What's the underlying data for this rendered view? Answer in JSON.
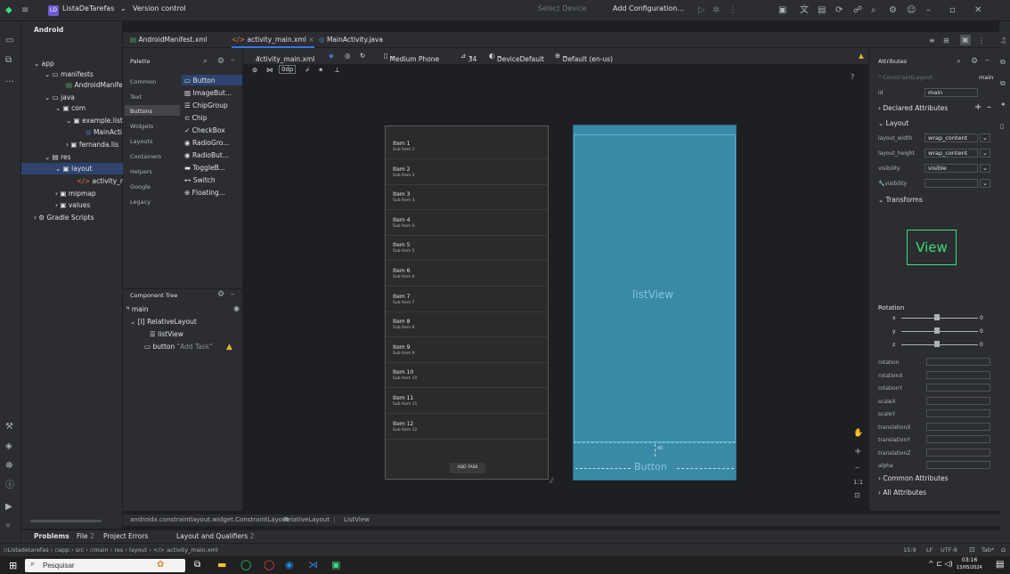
{
  "titlebar": {
    "project_badge": "LD",
    "project_name": "ListaDeTarefas",
    "vcs": "Version control",
    "select_device": "Select Device",
    "run_config": "Add Configuration..."
  },
  "project_panel": {
    "view_mode": "Android",
    "tree": [
      {
        "label": "app"
      },
      {
        "label": "manifests"
      },
      {
        "label": "AndroidManife"
      },
      {
        "label": "java"
      },
      {
        "label": "com"
      },
      {
        "label": "example.list"
      },
      {
        "label": "MainActi"
      },
      {
        "label": "fernanda.lis"
      },
      {
        "label": "res"
      },
      {
        "label": "layout"
      },
      {
        "label": "activity_mai"
      },
      {
        "label": "mipmap"
      },
      {
        "label": "values"
      },
      {
        "label": "Gradle Scripts"
      }
    ]
  },
  "editor_tabs": [
    "AndroidManifest.xml",
    "activity_main.xml",
    "MainActivity.java"
  ],
  "palette": {
    "title": "Palette",
    "categories": [
      "Common",
      "Text",
      "Buttons",
      "Widgets",
      "Layouts",
      "Containers",
      "Helpers",
      "Google",
      "Legacy"
    ],
    "items": [
      "Button",
      "ImageBut...",
      "ChipGroup",
      "Chip",
      "CheckBox",
      "RadioGro...",
      "RadioBut...",
      "ToggleB...",
      "Switch",
      "Floating..."
    ]
  },
  "design_toolbar": {
    "file": "activity_main.xml",
    "dp": "0dp",
    "device": "Medium Phone",
    "api": "34",
    "theme": "DeviceDefault",
    "locale": "Default (en-us)"
  },
  "component_tree": {
    "title": "Component Tree",
    "root": "main",
    "relative": "RelativeLayout",
    "list": "listView",
    "button": "button",
    "button_hint": "\"Add Task\""
  },
  "preview": {
    "items": [
      {
        "title": "Item 1",
        "sub": "Sub Item 1"
      },
      {
        "title": "Item 2",
        "sub": "Sub Item 2"
      },
      {
        "title": "Item 3",
        "sub": "Sub Item 3"
      },
      {
        "title": "Item 4",
        "sub": "Sub Item 4"
      },
      {
        "title": "Item 5",
        "sub": "Sub Item 5"
      },
      {
        "title": "Item 6",
        "sub": "Sub Item 6"
      },
      {
        "title": "Item 7",
        "sub": "Sub Item 7"
      },
      {
        "title": "Item 8",
        "sub": "Sub Item 8"
      },
      {
        "title": "Item 9",
        "sub": "Sub Item 9"
      },
      {
        "title": "Item 10",
        "sub": "Sub Item 10"
      },
      {
        "title": "Item 11",
        "sub": "Sub Item 11"
      },
      {
        "title": "Item 12",
        "sub": "Sub Item 12"
      }
    ],
    "add_task": "ADD TASK",
    "blueprint_list": "listView",
    "blueprint_button": "Button",
    "blueprint_margin": "40"
  },
  "attributes": {
    "title": "Attributes",
    "class": "ConstraintLayout",
    "class_id": "main",
    "id_label": "id",
    "id_value": "main",
    "declared": "Declared Attributes",
    "layout": "Layout",
    "layout_width_label": "layout_width",
    "layout_width": "wrap_content",
    "layout_height_label": "layout_height",
    "layout_height": "wrap_content",
    "visibility_label": "visibility",
    "visibility": "visible",
    "tools_visibility_label": "visibility",
    "transforms": "Transforms",
    "view_box": "View",
    "rotation_title": "Rotation",
    "rot_x": "x",
    "rot_y": "y",
    "rot_z": "z",
    "rot_x_val": "0",
    "rot_y_val": "0",
    "rot_z_val": "0",
    "transform_fields": [
      "rotation",
      "rotationX",
      "rotationY",
      "scaleX",
      "scaleY",
      "translationX",
      "translationY",
      "translationZ",
      "alpha"
    ],
    "common": "Common Attributes",
    "all": "All Attributes"
  },
  "breadcrumb": [
    "androidx.constraintlayout.widget.ConstraintLayout",
    "RelativeLayout",
    "ListView"
  ],
  "problems_bar": {
    "problems": "Problems",
    "file": "File",
    "file_count": "2",
    "project_errors": "Project Errors",
    "layout_qual": "Layout and Qualifiers",
    "layout_count": "2"
  },
  "statusbar": {
    "path": [
      "Listadetarefas",
      "app",
      "src",
      "main",
      "res",
      "layout",
      "activity_main.xml"
    ],
    "position": "15:9",
    "line_sep": "LF",
    "encoding": "UTF-8",
    "indent": "Tab*"
  },
  "taskbar": {
    "search": "Pesquisar",
    "time": "03:16",
    "date": "13/05/2024"
  }
}
